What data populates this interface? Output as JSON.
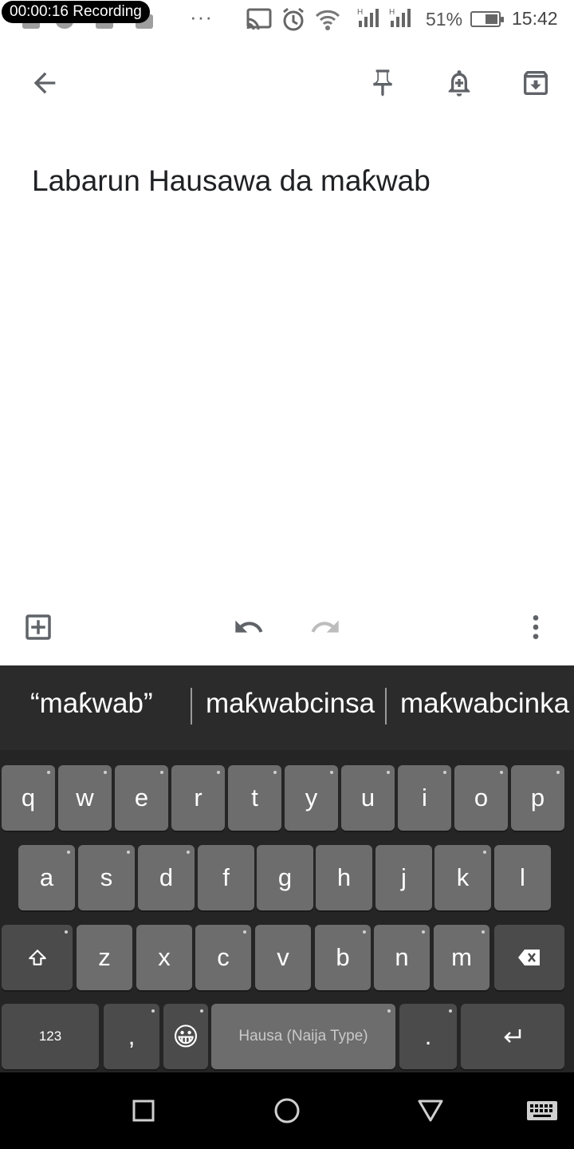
{
  "status_bar": {
    "recording_time": "00:00:16",
    "recording_label": "Recording",
    "more_dots": "···",
    "battery_percent": "51%",
    "battery_level": 0.51,
    "time": "15:42"
  },
  "toolbar": {
    "back_icon": "arrow-left-icon",
    "pin_icon": "pin-icon",
    "reminder_icon": "bell-plus-icon",
    "archive_icon": "archive-icon"
  },
  "note": {
    "title": "Labarun Hausawa da maƙwab"
  },
  "edit_bar": {
    "add_icon": "add-box-icon",
    "undo_icon": "undo-icon",
    "redo_icon": "redo-icon",
    "more_icon": "more-vert-icon"
  },
  "keyboard": {
    "suggestions": [
      "“maƙwab”",
      "maƙwabcinsa",
      "maƙwabcinka"
    ],
    "rows": [
      [
        "q",
        "w",
        "e",
        "r",
        "t",
        "y",
        "u",
        "i",
        "o",
        "p"
      ],
      [
        "a",
        "s",
        "d",
        "f",
        "g",
        "h",
        "j",
        "k",
        "l"
      ],
      [
        "z",
        "x",
        "c",
        "v",
        "b",
        "n",
        "m"
      ]
    ],
    "numbers_key": "123",
    "comma_key": ",",
    "emoji_key": "😀",
    "space_label": "Hausa (Naija Type)",
    "period_key": ".",
    "shift_icon": "shift-icon",
    "backspace_icon": "backspace-icon",
    "enter_icon": "enter-icon"
  },
  "nav_bar": {
    "recents_icon": "square-icon",
    "home_icon": "circle-icon",
    "back_icon": "triangle-back-icon",
    "keyboard_icon": "keyboard-icon"
  },
  "colors": {
    "keyboard_bg": "#252525",
    "key_bg": "#6d6d6d",
    "key_dark_bg": "#4b4b4b",
    "icon_gray": "#5f6368",
    "disabled_gray": "#bdbdbd"
  }
}
